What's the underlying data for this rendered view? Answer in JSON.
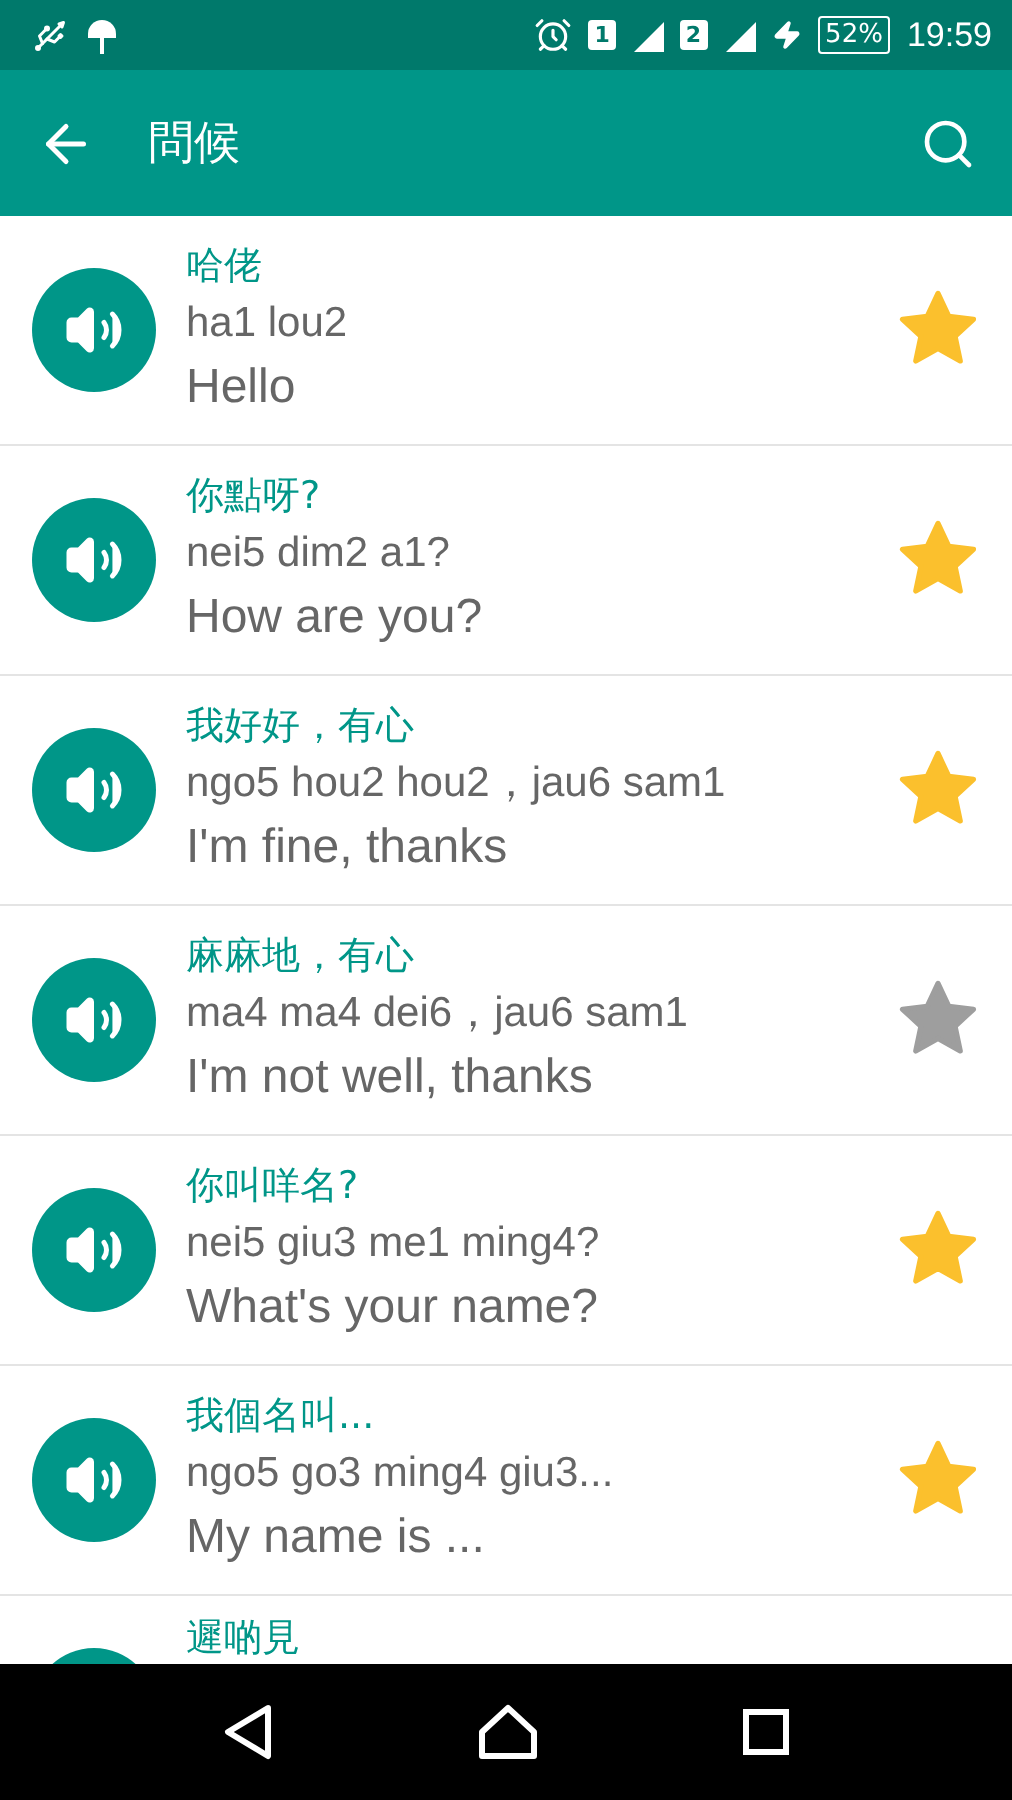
{
  "status_bar": {
    "sim_1": "1",
    "sim_2": "2",
    "battery": "52%",
    "time": "19:59"
  },
  "app_bar": {
    "title": "問候"
  },
  "phrases": [
    {
      "chinese": "哈佬",
      "jyutping": "ha1 lou2",
      "english": "Hello",
      "starred": true
    },
    {
      "chinese": "你點呀?",
      "jyutping": "nei5 dim2 a1?",
      "english": "How are you?",
      "starred": true
    },
    {
      "chinese": "我好好，有心",
      "jyutping": "ngo5 hou2 hou2，jau6 sam1",
      "english": "I'm fine, thanks",
      "starred": true
    },
    {
      "chinese": "麻麻地，有心",
      "jyutping": "ma4 ma4 dei6，jau6 sam1",
      "english": "I'm not well, thanks",
      "starred": false
    },
    {
      "chinese": "你叫咩名?",
      "jyutping": "nei5 giu3 me1 ming4?",
      "english": "What's your name?",
      "starred": true
    },
    {
      "chinese": "我個名叫...",
      "jyutping": "ngo5 go3 ming4 giu3...",
      "english": "My name is ...",
      "starred": true
    }
  ],
  "partial_phrase": {
    "chinese": "遲啲見"
  }
}
